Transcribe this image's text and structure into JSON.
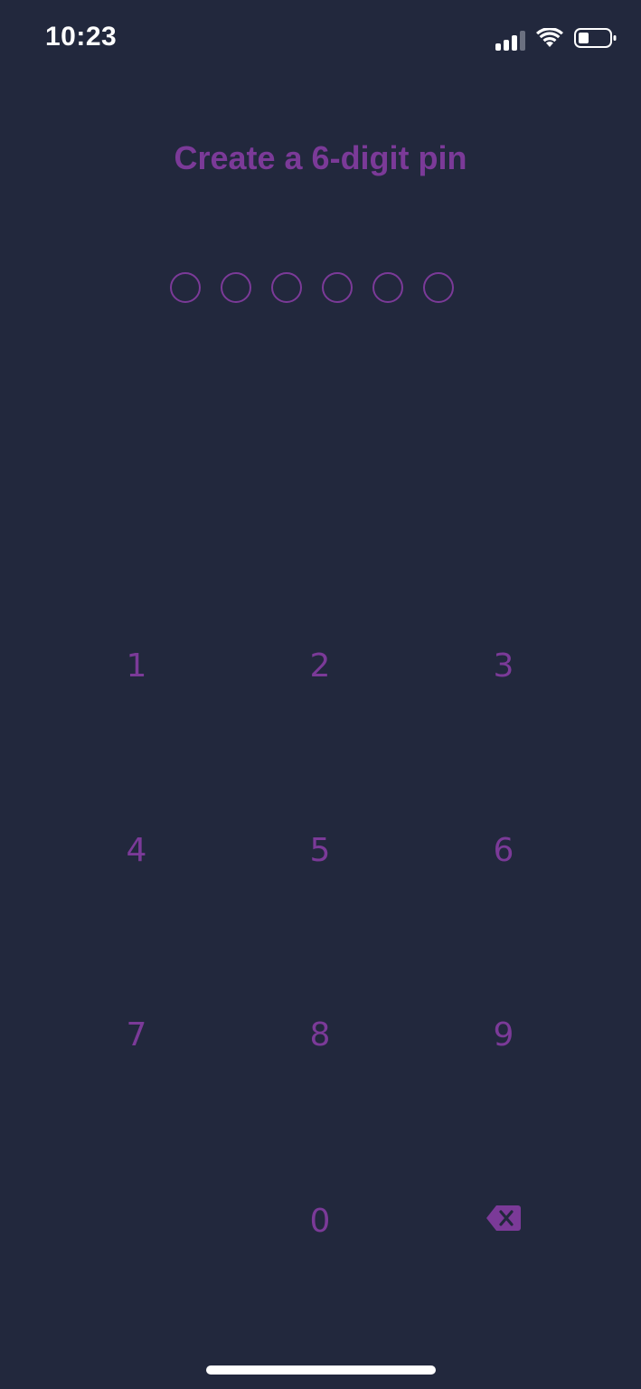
{
  "status_bar": {
    "time": "10:23",
    "icons": [
      "cellular-signal-icon",
      "wifi-icon",
      "battery-icon"
    ]
  },
  "title": "Create a 6-digit pin",
  "pin": {
    "length": 6,
    "entered": 0
  },
  "keypad": {
    "keys": [
      "1",
      "2",
      "3",
      "4",
      "5",
      "6",
      "7",
      "8",
      "9",
      "0"
    ],
    "delete_icon": "backspace-icon"
  },
  "colors": {
    "background": "#22283d",
    "accent": "#7b3a98",
    "status_text": "#ffffff"
  }
}
